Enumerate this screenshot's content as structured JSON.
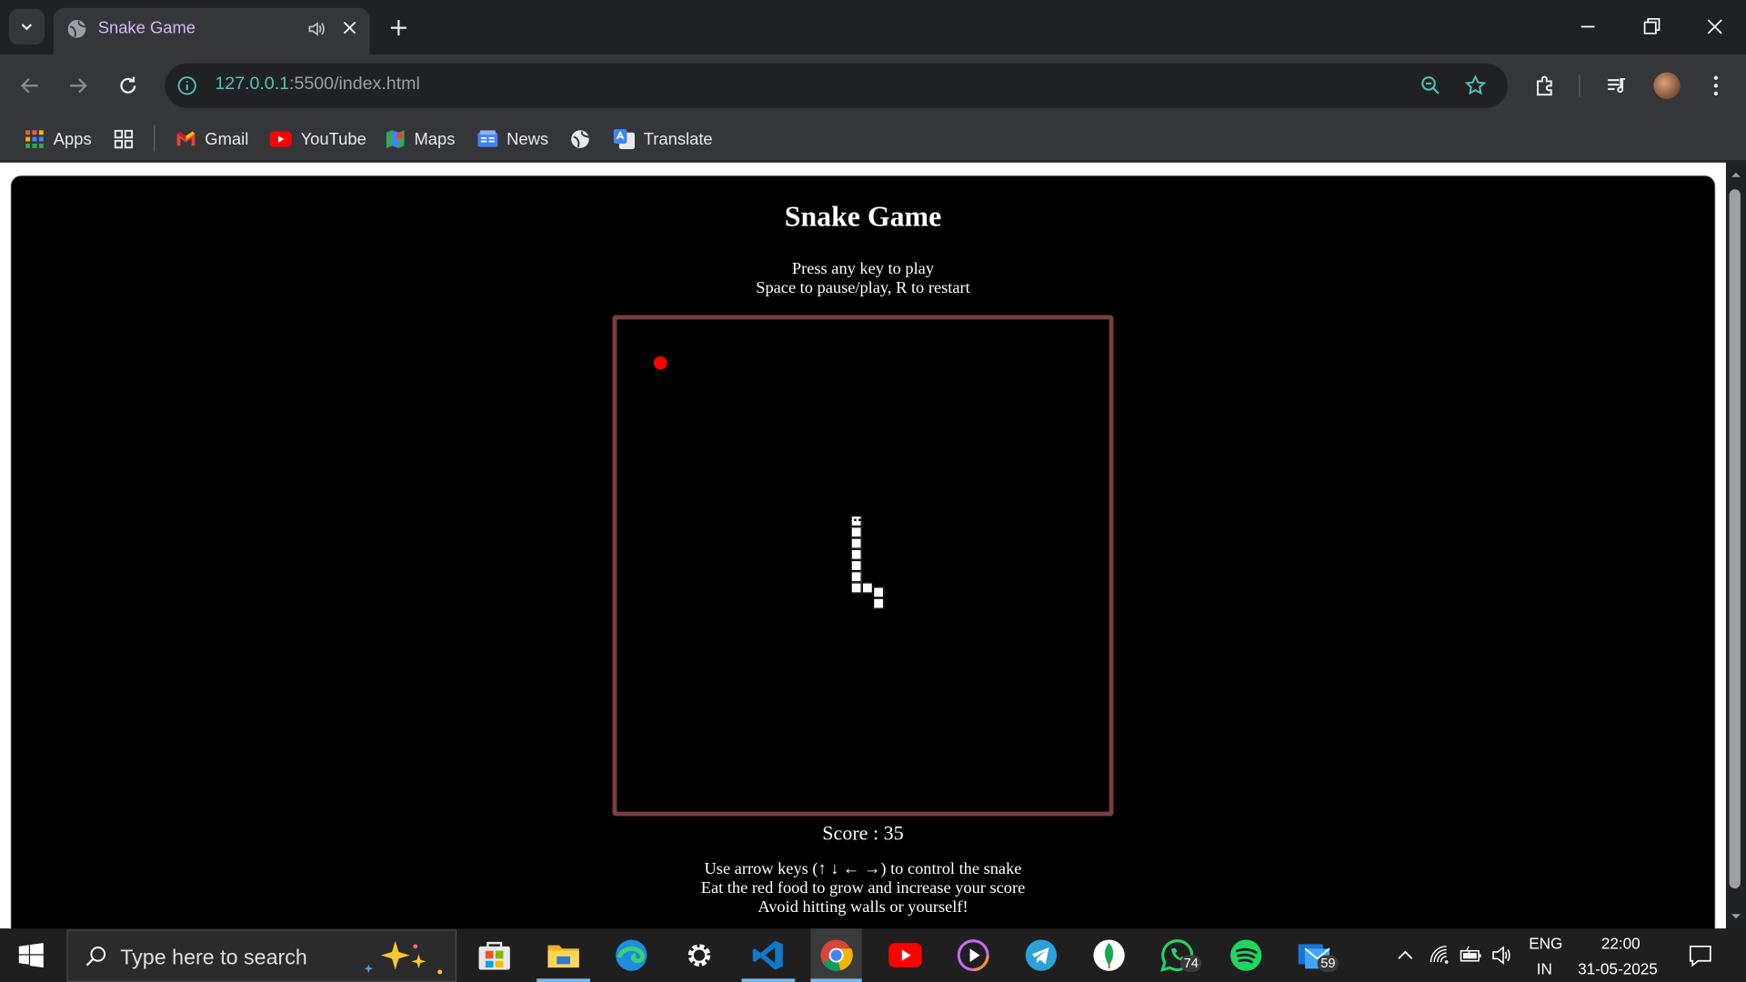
{
  "browser": {
    "tab_title": "Snake Game",
    "url_host": "127.0.0.1",
    "url_path": ":5500/index.html"
  },
  "bookmarks": [
    {
      "label": "Apps"
    },
    {
      "label": "Gmail"
    },
    {
      "label": "YouTube"
    },
    {
      "label": "Maps"
    },
    {
      "label": "News"
    },
    {
      "label": "Translate"
    }
  ],
  "game": {
    "title": "Snake Game",
    "instruction_1": "Press any key to play",
    "instruction_2": "Space to pause/play, R to restart",
    "score_text": "Score : 35",
    "help_1": "Use arrow keys (↑ ↓ ← →) to control the snake",
    "help_2": "Eat the red food to grow and increase your score",
    "help_3": "Avoid hitting walls or yourself!",
    "border_color": "#7b3d3e",
    "food_color": "#ff0000"
  },
  "taskbar": {
    "search_placeholder": "Type here to search",
    "whatsapp_badge": "74",
    "mail_badge": "59",
    "lang_1": "ENG",
    "lang_2": "IN",
    "time": "22:00",
    "date": "31-05-2025"
  }
}
